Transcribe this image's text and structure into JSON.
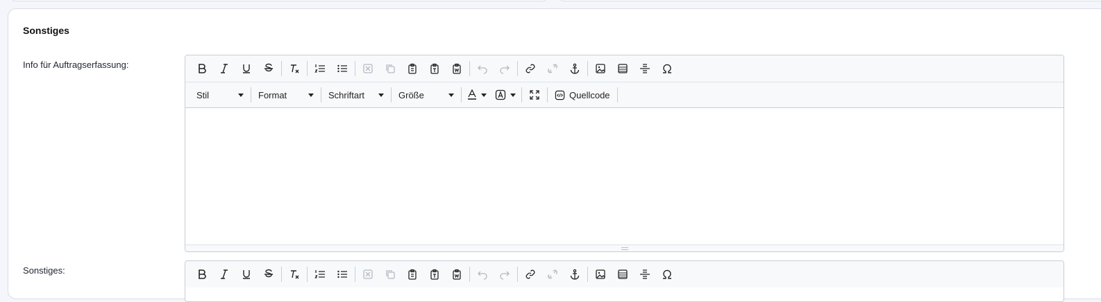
{
  "section": {
    "title": "Sonstiges"
  },
  "fields": [
    {
      "label": "Info für Auftragserfassung:"
    },
    {
      "label": "Sonstiges:"
    }
  ],
  "toolbar": {
    "style_label": "Stil",
    "format_label": "Format",
    "font_label": "Schriftart",
    "size_label": "Größe",
    "source_label": "Quellcode"
  }
}
